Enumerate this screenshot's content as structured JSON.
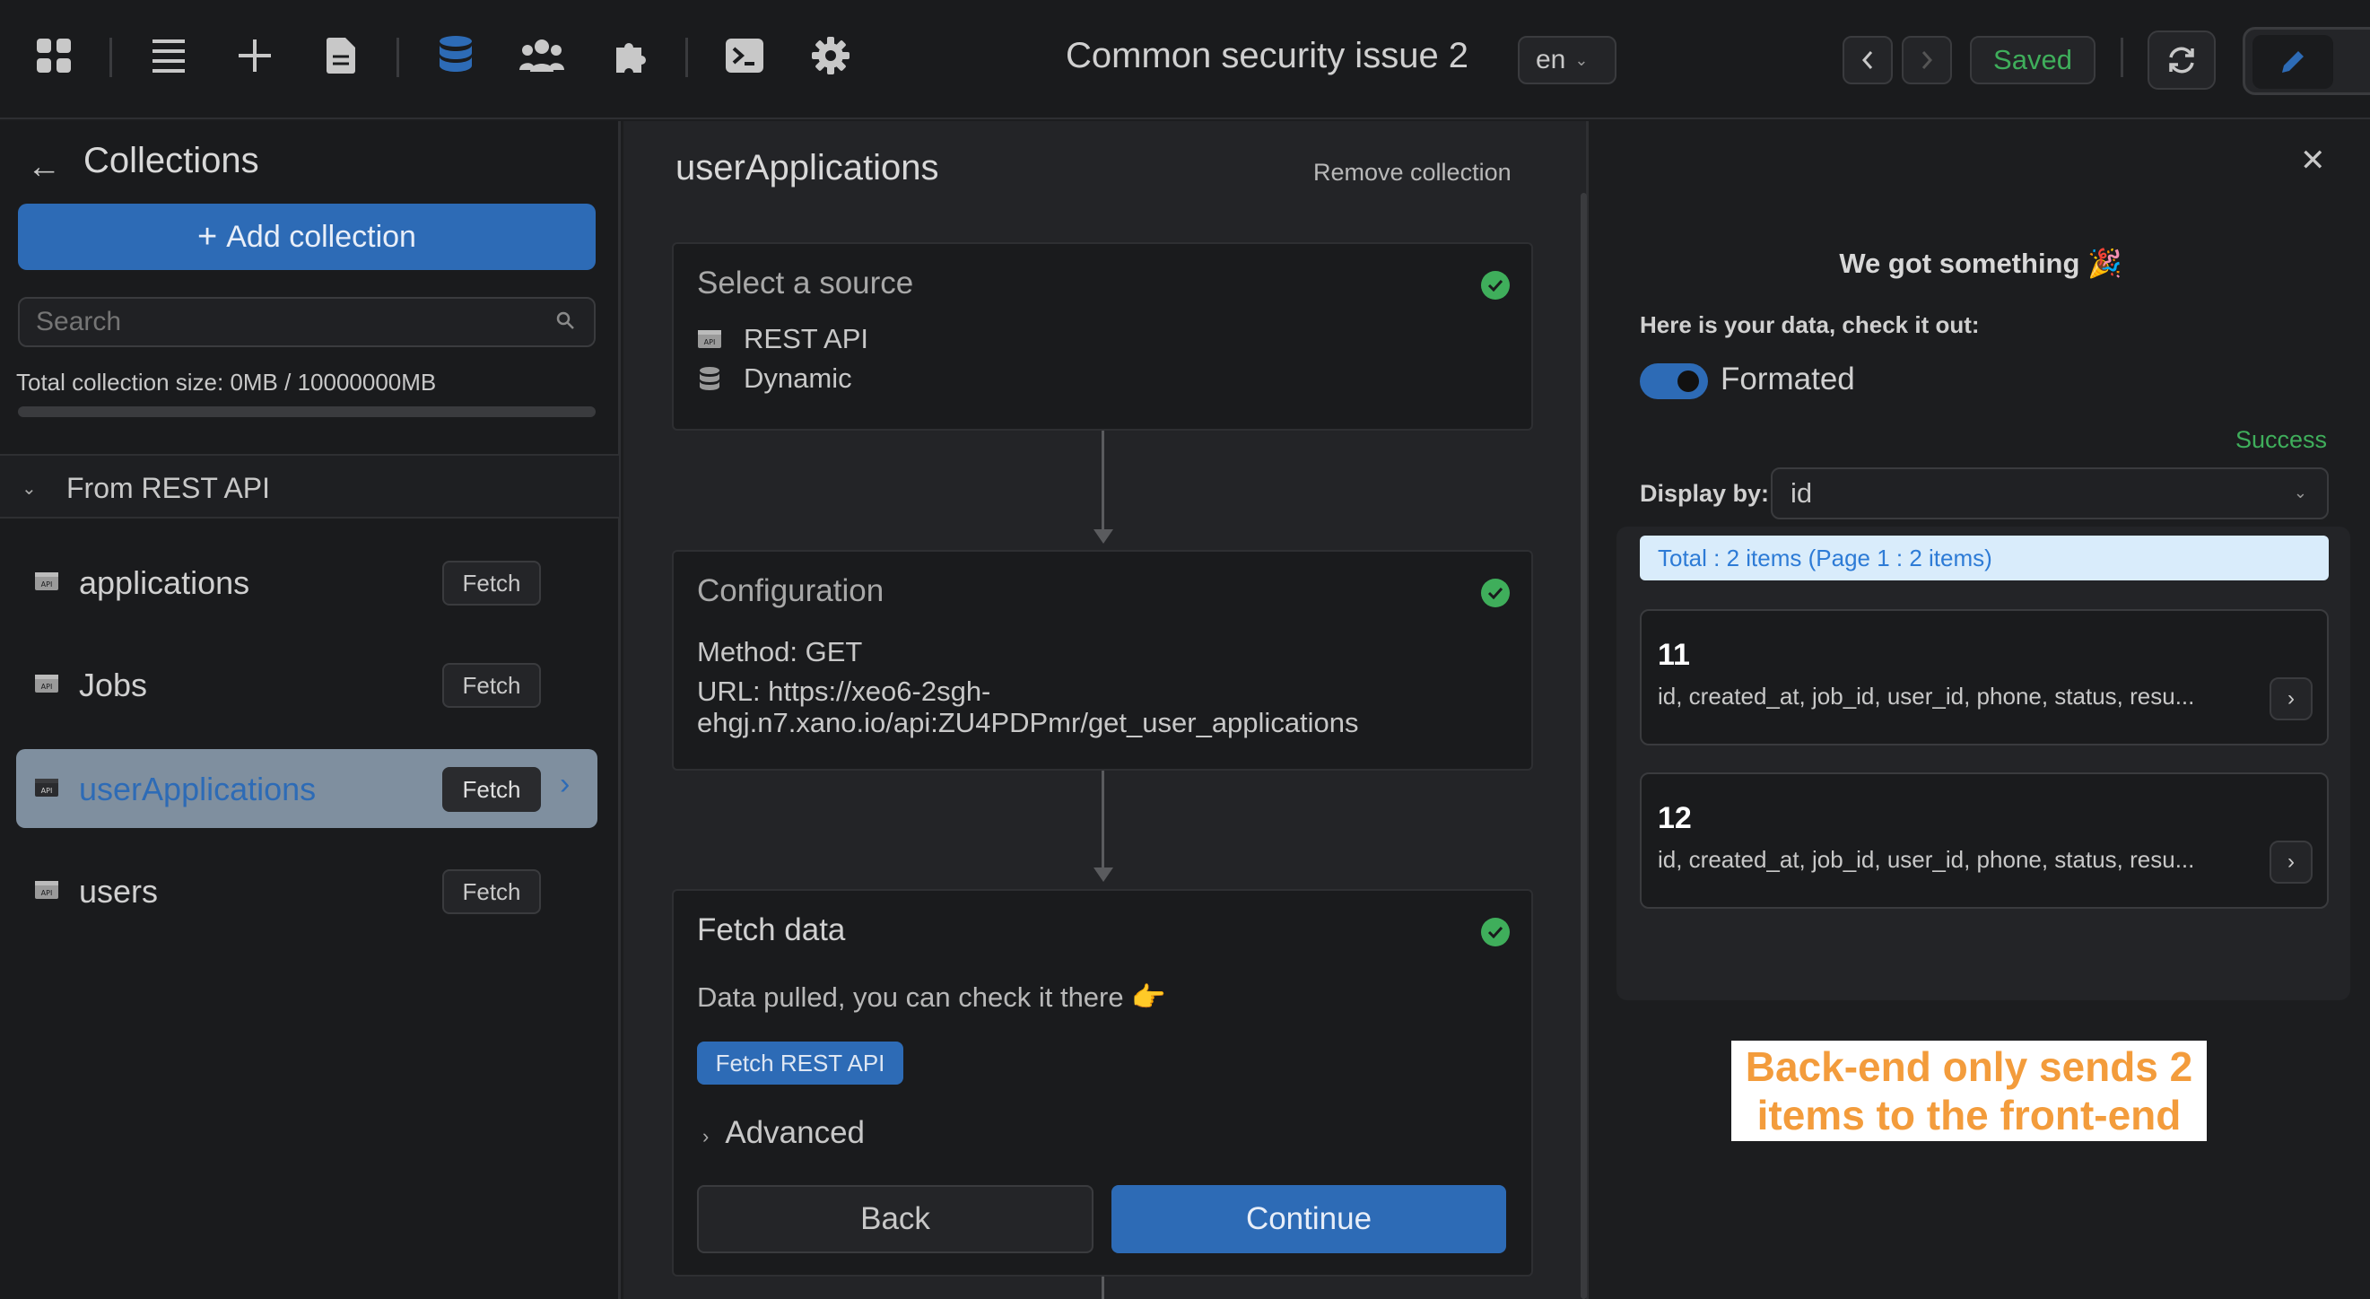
{
  "header": {
    "title": "Common security issue 2",
    "language": "en",
    "saved_label": "Saved",
    "icons": [
      "grid-icon",
      "list-icon",
      "plus-icon",
      "page-icon",
      "database-icon",
      "users-icon",
      "plugin-icon",
      "terminal-icon",
      "gear-icon",
      "chevron-left-icon",
      "chevron-right-icon",
      "refresh-icon",
      "edit-icon"
    ],
    "accent": "#2d6bb6",
    "success_color": "#3fae5b"
  },
  "sidebar": {
    "title": "Collections",
    "add_label": "Add collection",
    "search_placeholder": "Search",
    "total_size": "Total collection size: 0MB / 10000000MB",
    "group_label": "From REST API",
    "items": [
      {
        "name": "applications",
        "badge": "Fetch"
      },
      {
        "name": "Jobs",
        "badge": "Fetch"
      },
      {
        "name": "userApplications",
        "badge": "Fetch",
        "active": true
      },
      {
        "name": "users",
        "badge": "Fetch"
      }
    ]
  },
  "main": {
    "title": "userApplications",
    "remove_label": "Remove collection",
    "source": {
      "title": "Select a source",
      "rest": "REST API",
      "dynamic": "Dynamic"
    },
    "config": {
      "title": "Configuration",
      "method": "Method: GET",
      "url_line1": "URL: https://xeo6-2sgh-",
      "url_line2": "ehgj.n7.xano.io/api:ZU4PDPmr/get_user_applications"
    },
    "fetch": {
      "title": "Fetch data",
      "message": "Data pulled, you can check it there 👉",
      "button": "Fetch REST API",
      "advanced": "Advanced",
      "back": "Back",
      "continue": "Continue"
    }
  },
  "result": {
    "heading": "We got something 🎉",
    "subheading": "Here is your data, check it out:",
    "toggle_label": "Formated",
    "status": "Success",
    "display_by_label": "Display by:",
    "display_by_value": "id",
    "total": "Total : 2 items (Page 1 : 2 items)",
    "items": [
      {
        "id": "11",
        "fields": "id, created_at, job_id, user_id, phone, status, resu..."
      },
      {
        "id": "12",
        "fields": "id, created_at, job_id, user_id, phone, status, resu..."
      }
    ]
  },
  "annotation": {
    "line1": "Back-end only sends 2",
    "line2": "items to the front-end"
  }
}
